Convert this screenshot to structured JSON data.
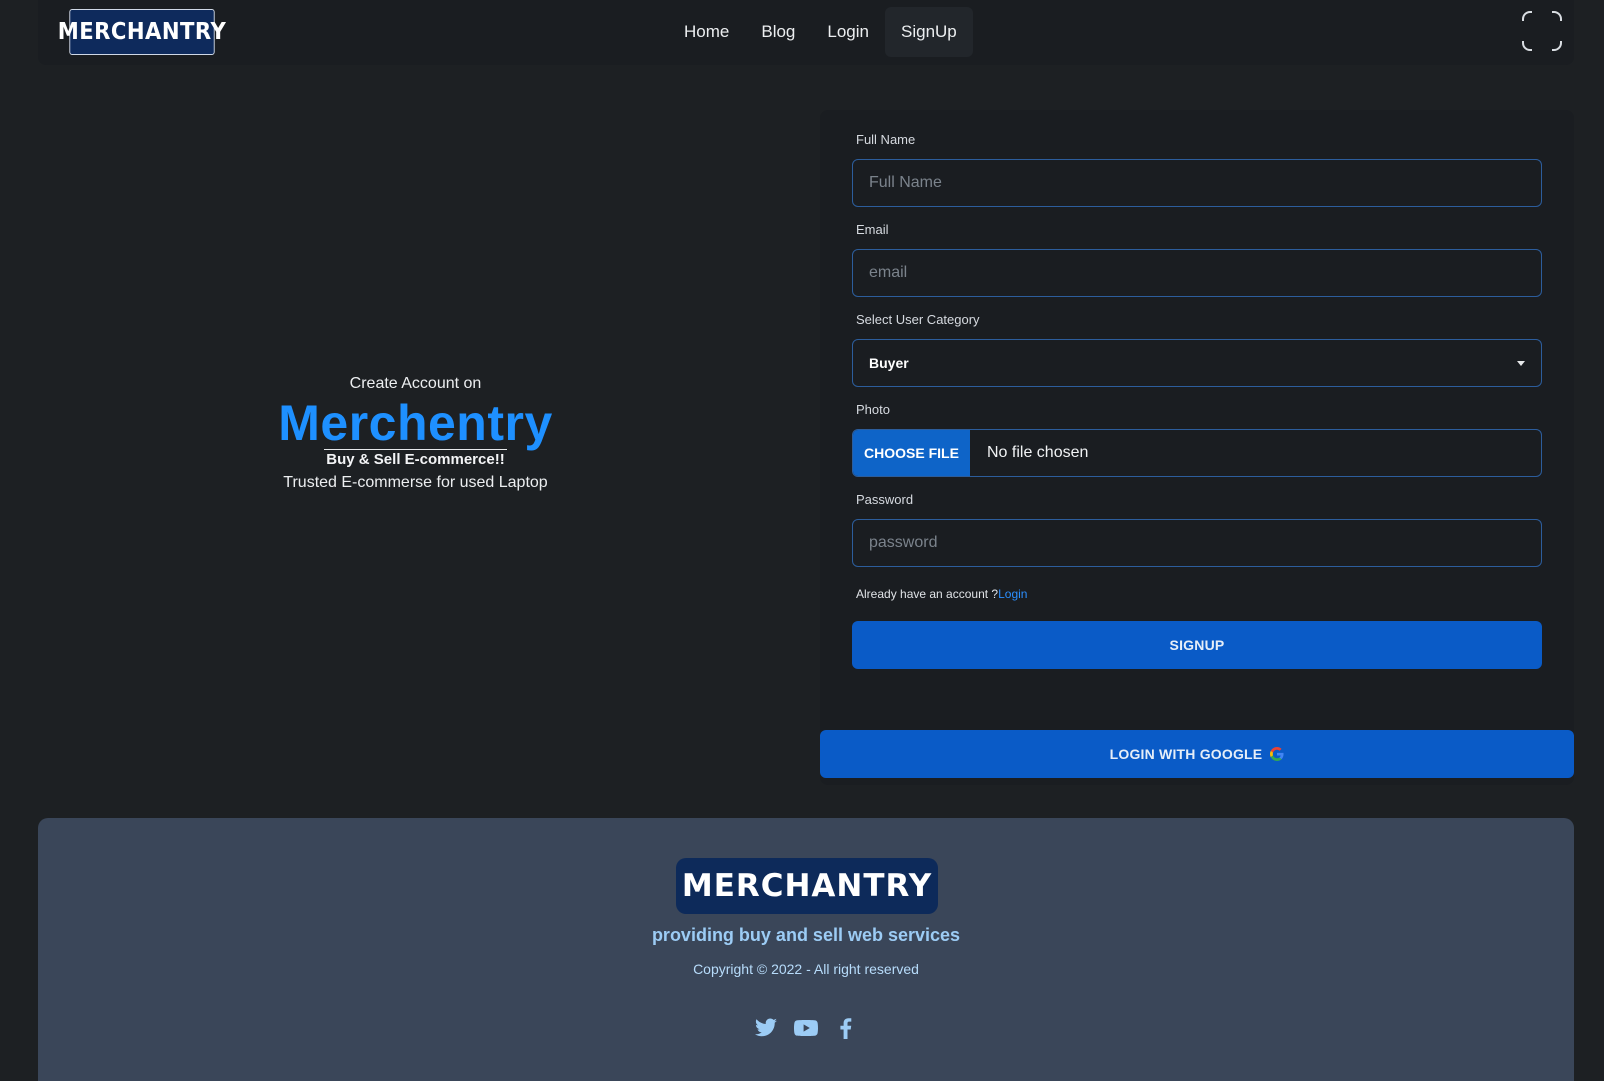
{
  "nav": {
    "logo_text": "MERCHANTRY",
    "links": [
      "Home",
      "Blog",
      "Login",
      "SignUp"
    ],
    "active_link": "SignUp"
  },
  "hero": {
    "pre_title": "Create Account on",
    "brand": "Merchentry",
    "tagline": "Buy & Sell E-commerce!!",
    "subtitle": "Trusted E-commerse for used Laptop"
  },
  "form": {
    "full_name": {
      "label": "Full Name",
      "placeholder": "Full Name",
      "value": ""
    },
    "email": {
      "label": "Email",
      "placeholder": "email",
      "value": ""
    },
    "category": {
      "label": "Select User Category",
      "selected": "Buyer"
    },
    "photo": {
      "label": "Photo",
      "button": "CHOOSE FILE",
      "status": "No file chosen"
    },
    "password": {
      "label": "Password",
      "placeholder": "password",
      "value": ""
    },
    "hint_text": "Already have an account ?",
    "hint_link": "Login",
    "signup_button": "SIGNUP",
    "google_button": "LOGIN WITH GOOGLE"
  },
  "footer": {
    "logo_text": "MERCHANTRY",
    "tagline": "providing buy and sell web services",
    "copyright": "Copyright © 2022 - All right reserved",
    "socials": [
      "twitter-icon",
      "youtube-icon",
      "facebook-icon"
    ]
  },
  "colors": {
    "accent": "#0a5bc7",
    "brand_blue": "#1e90ff",
    "background": "#1d2023",
    "footer_bg": "#3a4659"
  }
}
